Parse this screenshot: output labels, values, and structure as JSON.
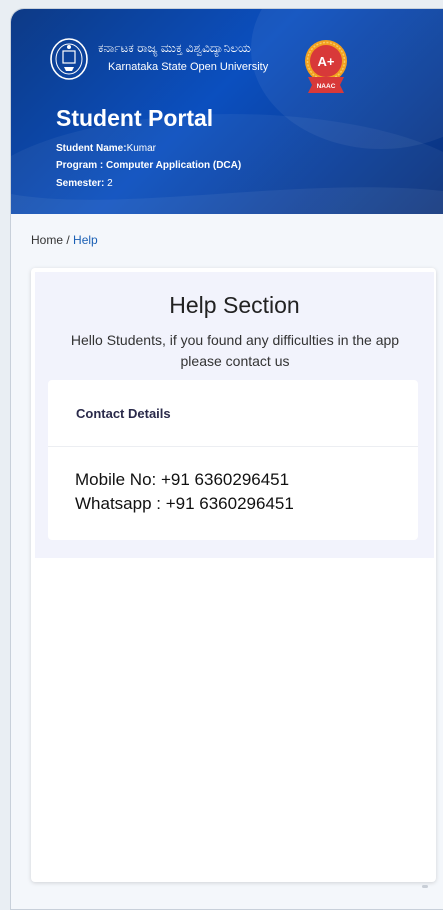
{
  "header": {
    "kannada_name": "ಕರ್ನಾಟಕ ರಾಜ್ಯ ಮುಕ್ತ ವಿಶ್ವವಿದ್ಯಾನಿಲಯ",
    "english_name": "Karnataka State Open University",
    "naac_grade": "A+",
    "naac_label": "NAAC",
    "portal_title": "Student Portal",
    "student_name_label": "Student Name:",
    "student_name": "Kumar",
    "program_text": "Program : Computer Application (DCA)",
    "semester_label": "Semester:",
    "semester_value": " 2"
  },
  "breadcrumb": {
    "home": "Home",
    "separator": " / ",
    "current": "Help"
  },
  "help": {
    "title": "Help Section",
    "message": "Hello Students, if you found any difficulties in the app please contact us",
    "contact_heading": "Contact Details",
    "mobile_line": "Mobile No:  +91 6360296451",
    "whatsapp_line": "Whatsapp : +91 6360296451"
  },
  "icons": {
    "emblem": "university-emblem-icon",
    "badge": "naac-badge-icon"
  },
  "colors": {
    "header_blue": "#0b4fbf",
    "badge_orange": "#f39c12",
    "badge_red": "#d62d2d",
    "link": "#1a5fb4"
  }
}
